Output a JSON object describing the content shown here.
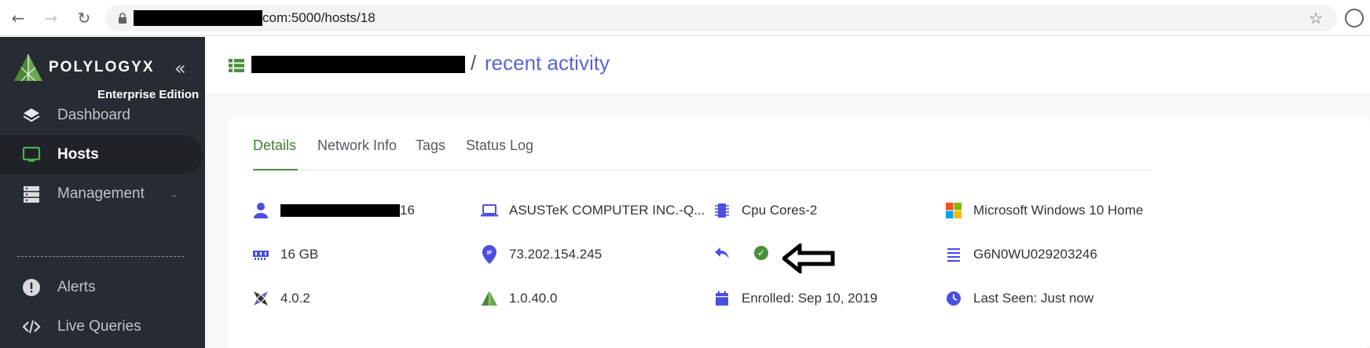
{
  "browser": {
    "url_visible": "com:5000/hosts/18"
  },
  "sidebar": {
    "brand": "POLYLOGYX",
    "edition": "Enterprise Edition",
    "items": [
      {
        "label": "Dashboard",
        "icon": "layers-icon"
      },
      {
        "label": "Hosts",
        "icon": "monitor-icon",
        "active": true
      },
      {
        "label": "Management",
        "icon": "server-icon",
        "has_submenu": true
      },
      {
        "label": "Alerts",
        "icon": "alert-icon"
      },
      {
        "label": "Live Queries",
        "icon": "code-icon"
      }
    ]
  },
  "header": {
    "separator": "/",
    "page_title": "recent activity"
  },
  "tabs": [
    {
      "label": "Details",
      "active": true
    },
    {
      "label": "Network Info"
    },
    {
      "label": "Tags"
    },
    {
      "label": "Status Log"
    }
  ],
  "details": {
    "user_suffix": "16",
    "hardware": "ASUSTeK COMPUTER INC.-Q...",
    "cpu": "Cpu Cores-2",
    "os": "Microsoft Windows 10 Home",
    "memory": "16 GB",
    "ip": "73.202.154.245",
    "serial": "G6N0WU029203246",
    "osquery_version": "4.0.2",
    "extension_version": "1.0.40.0",
    "enrolled": "Enrolled: Sep 10, 2019",
    "last_seen": "Last Seen: Just now"
  },
  "colors": {
    "sidebar_bg": "#272c33",
    "accent_green": "#4a8f3a",
    "link_blue": "#5b64d6",
    "icon_blue": "#4b4fe0"
  }
}
